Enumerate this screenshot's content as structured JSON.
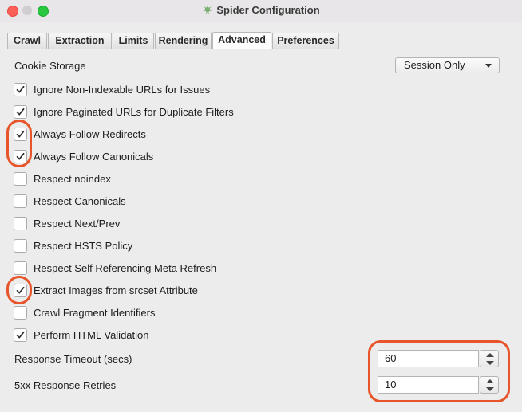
{
  "window": {
    "title": "Spider Configuration"
  },
  "tabs": [
    "Crawl",
    "Extraction",
    "Limits",
    "Rendering",
    "Advanced",
    "Preferences"
  ],
  "active_tab": "Advanced",
  "cookie_storage": {
    "label": "Cookie Storage",
    "value": "Session Only"
  },
  "checkboxes": [
    {
      "label": "Ignore Non-Indexable URLs for Issues",
      "checked": true
    },
    {
      "label": "Ignore Paginated URLs for Duplicate Filters",
      "checked": true
    },
    {
      "label": "Always Follow Redirects",
      "checked": true
    },
    {
      "label": "Always Follow Canonicals",
      "checked": true
    },
    {
      "label": "Respect noindex",
      "checked": false
    },
    {
      "label": "Respect Canonicals",
      "checked": false
    },
    {
      "label": "Respect Next/Prev",
      "checked": false
    },
    {
      "label": "Respect HSTS Policy",
      "checked": false
    },
    {
      "label": "Respect Self Referencing Meta Refresh",
      "checked": false
    },
    {
      "label": "Extract Images from srcset Attribute",
      "checked": true
    },
    {
      "label": "Crawl Fragment Identifiers",
      "checked": false
    },
    {
      "label": "Perform HTML Validation",
      "checked": true
    }
  ],
  "response_timeout": {
    "label": "Response Timeout (secs)",
    "value": "60"
  },
  "retries": {
    "label": "5xx Response Retries",
    "value": "10"
  },
  "colors": {
    "annotation": "#e8552a",
    "background": "#ececec"
  },
  "icons": {
    "title": "spider-leaf-icon",
    "check": "checkmark-icon"
  }
}
